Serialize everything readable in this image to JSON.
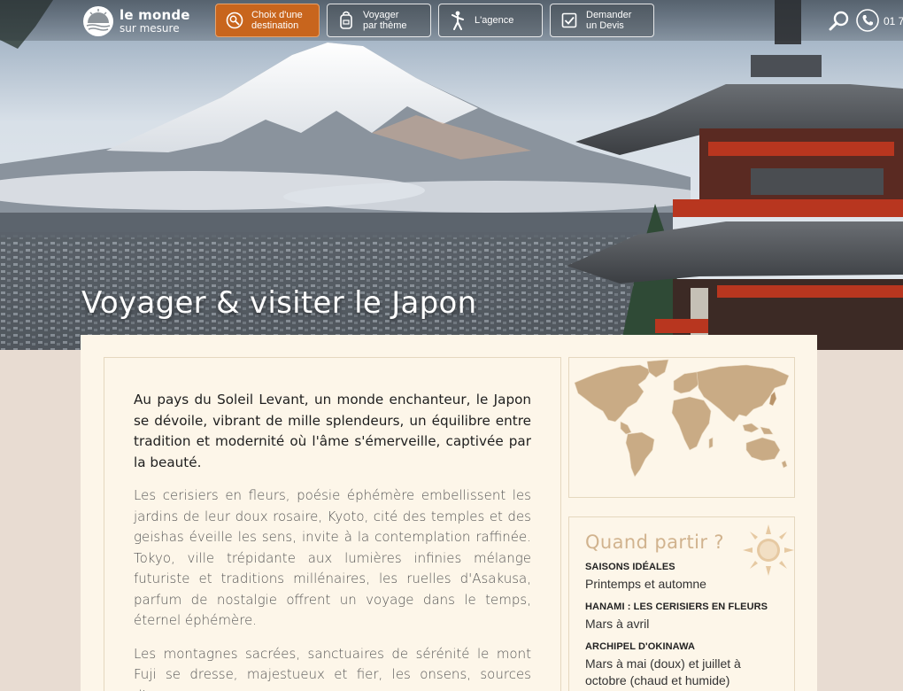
{
  "brand": {
    "line1": "le monde",
    "line2": "sur mesure"
  },
  "nav": {
    "buttons": [
      {
        "label": "Choix d'une\ndestination",
        "icon": "map-search-icon",
        "active": true
      },
      {
        "label": "Voyager\npar thème",
        "icon": "backpack-icon",
        "active": false
      },
      {
        "label": "L'agence",
        "icon": "person-icon",
        "active": false
      },
      {
        "label": "Demander\nun Devis",
        "icon": "checkbox-icon",
        "active": false
      }
    ],
    "phone_text": "01 7"
  },
  "hero": {
    "title": "Voyager & visiter le Japon"
  },
  "article": {
    "paragraphs": [
      "Au pays du Soleil Levant, un monde enchanteur, le Japon se dévoile, vibrant de mille splendeurs, un équilibre entre tradition et modernité où l'âme s'émerveille, captivée par la beauté.",
      " Les cerisiers en fleurs, poésie éphémère embellissent les jardins de leur doux rosaire, Kyoto, cité des temples et des geishas éveille les sens, invite à la contemplation raffinée. Tokyo, ville trépidante aux lumières infinies mélange futuriste et traditions millénaires, les ruelles d'Asakusa, parfum de nostalgie offrent un voyage dans le temps, éternel éphémère.",
      "Les montagnes sacrées, sanctuaires de sérénité le mont Fuji se dresse, majestueux et fier, les onsens, sources d'eau"
    ]
  },
  "sidebar": {
    "when": {
      "title": "Quand partir ?",
      "items": [
        {
          "label": "SAISONS IDÉALES",
          "value": "Printemps et automne"
        },
        {
          "label": "HANAMI : LES CERISIERS EN FLEURS",
          "value": "Mars à avril"
        },
        {
          "label": "ARCHIPEL D'OKINAWA",
          "value": "Mars à mai (doux) et juillet à octobre (chaud et humide)"
        }
      ]
    }
  },
  "colors": {
    "accent": "#c8651d",
    "panel": "#fdf6e9",
    "map_land": "#c9ab85",
    "title_tan": "#d1b38e"
  }
}
